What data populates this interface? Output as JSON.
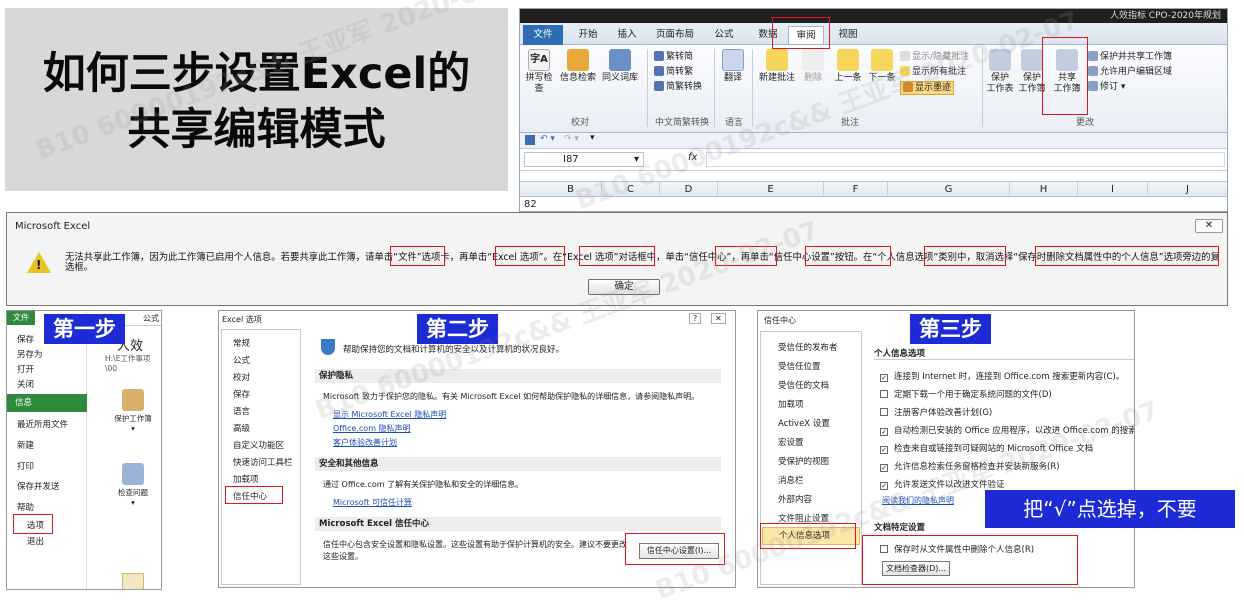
{
  "title": {
    "line1": "如何三步设置Excel的",
    "line2": "共享编辑模式"
  },
  "ribbon": {
    "window_title": "人效指标 CPO-2020年规划",
    "tabs": [
      "文件",
      "开始",
      "插入",
      "页面布局",
      "公式",
      "数据",
      "审阅",
      "视图"
    ],
    "active_tab": "审阅",
    "buttons": {
      "spell": "拼写检查",
      "research": "信息检索",
      "thesaurus": "同义词库",
      "to_trad": "繁转简",
      "to_simp": "简转繁",
      "convert": "简繁转换",
      "translate": "翻译",
      "new_comment": "新建批注",
      "delete": "删除",
      "prev": "上一条",
      "next": "下一条",
      "show_hide": "显示/隐藏批注",
      "show_all": "显示所有批注",
      "show_ink": "显示墨迹",
      "protect_sheet_1": "保护",
      "protect_sheet_2": "工作表",
      "protect_wb_1": "保护",
      "protect_wb_2": "工作簿",
      "share_1": "共享",
      "share_2": "工作簿",
      "protect_share": "保护并共享工作簿",
      "allow_edit": "允许用户编辑区域",
      "track": "修订"
    },
    "groups": [
      "校对",
      "中文简繁转换",
      "语言",
      "批注",
      "更改"
    ],
    "name_box": "I87",
    "fx": "fx",
    "columns": [
      "B",
      "C",
      "D",
      "E",
      "F",
      "G",
      "H",
      "I",
      "J"
    ],
    "row": "82"
  },
  "dialog": {
    "title": "Microsoft Excel",
    "close": "✕",
    "message": "无法共享此工作簿，因为此工作簿已启用个人信息。若要共享此工作簿，请单击“文件”选项卡，再单击“Excel 选项”。在“Excel 选项”对话框中，单击“信任中心”，再单击“信任中心设置”按钮。在“个人信息选项”类别中，取消选择“保存时删除文档属性中的个人信息”选项旁边的复选框。",
    "ok": "确定"
  },
  "step1": {
    "label": "第一步",
    "file_tab": "文件",
    "formula_tab": "公式",
    "items": [
      "保存",
      "另存为",
      "打开",
      "关闭",
      "信息",
      "最近所用文件",
      "新建",
      "打印",
      "保存并发送",
      "帮助",
      "选项",
      "退出"
    ],
    "doc_title": "人效",
    "path": "H:\\E工作事项\\00",
    "protect": "保护工作簿",
    "check": "检查问题"
  },
  "step2": {
    "label": "第二步",
    "title": "Excel 选项",
    "nav": [
      "常规",
      "公式",
      "校对",
      "保存",
      "语言",
      "高级",
      "自定义功能区",
      "快速访问工具栏",
      "加载项",
      "信任中心"
    ],
    "banner": "帮助保持您的文档和计算机的安全以及计算机的状况良好。",
    "privacy_header": "保护隐私",
    "privacy_text": "Microsoft 致力于保护您的隐私。有关 Microsoft Excel 如何帮助保护隐私的详细信息，请参阅隐私声明。",
    "links": [
      "显示 Microsoft Excel 隐私声明",
      "Office.com 隐私声明",
      "客户体验改善计划"
    ],
    "security_header": "安全和其他信息",
    "security_text": "通过 Office.com 了解有关保护隐私和安全的详细信息。",
    "security_link": "Microsoft 可信任计算",
    "tc_header": "Microsoft Excel 信任中心",
    "tc_text1": "信任中心包含安全设置和隐私设置。这些设置有助于保护计算机的安全。建议不要更改",
    "tc_text2": "这些设置。",
    "tc_button": "信任中心设置(I)..."
  },
  "step3": {
    "label": "第三步",
    "title": "信任中心",
    "nav": [
      "受信任的发布者",
      "受信任位置",
      "受信任的文档",
      "加载项",
      "ActiveX 设置",
      "宏设置",
      "受保护的视图",
      "消息栏",
      "外部内容",
      "文件阻止设置",
      "个人信息选项"
    ],
    "section1": "个人信息选项",
    "options": [
      {
        "checked": true,
        "text": "连接到 Internet 时，连接到 Office.com 搜索更新内容(C)。"
      },
      {
        "checked": false,
        "text": "定期下载一个用于确定系统问题的文件(D)"
      },
      {
        "checked": false,
        "text": "注册客户体验改善计划(G)"
      },
      {
        "checked": true,
        "text": "自动检测已安装的 Office 应用程序，以改进 Office.com 的搜索结"
      },
      {
        "checked": true,
        "text": "检查来自或链接到可疑网站的 Microsoft Office 文档"
      },
      {
        "checked": true,
        "text": "允许信息检索任务窗格检查并安装新服务(R)"
      },
      {
        "checked": true,
        "text": "允许发送文件以改进文件验证"
      }
    ],
    "privacy_link": "阅读我们的隐私声明",
    "section2": "文档特定设置",
    "remove_option": "保存时从文件属性中删除个人信息(R)",
    "inspector": "文档检查器(D)..."
  },
  "note": "把“√”点选掉，不要",
  "watermark": "B10 60000192c&& 王亚军 2020-02-07",
  "colors": {
    "accent": "#1c2bd6",
    "highlight": "#e0161c",
    "file_tab": "#2c6db5"
  }
}
